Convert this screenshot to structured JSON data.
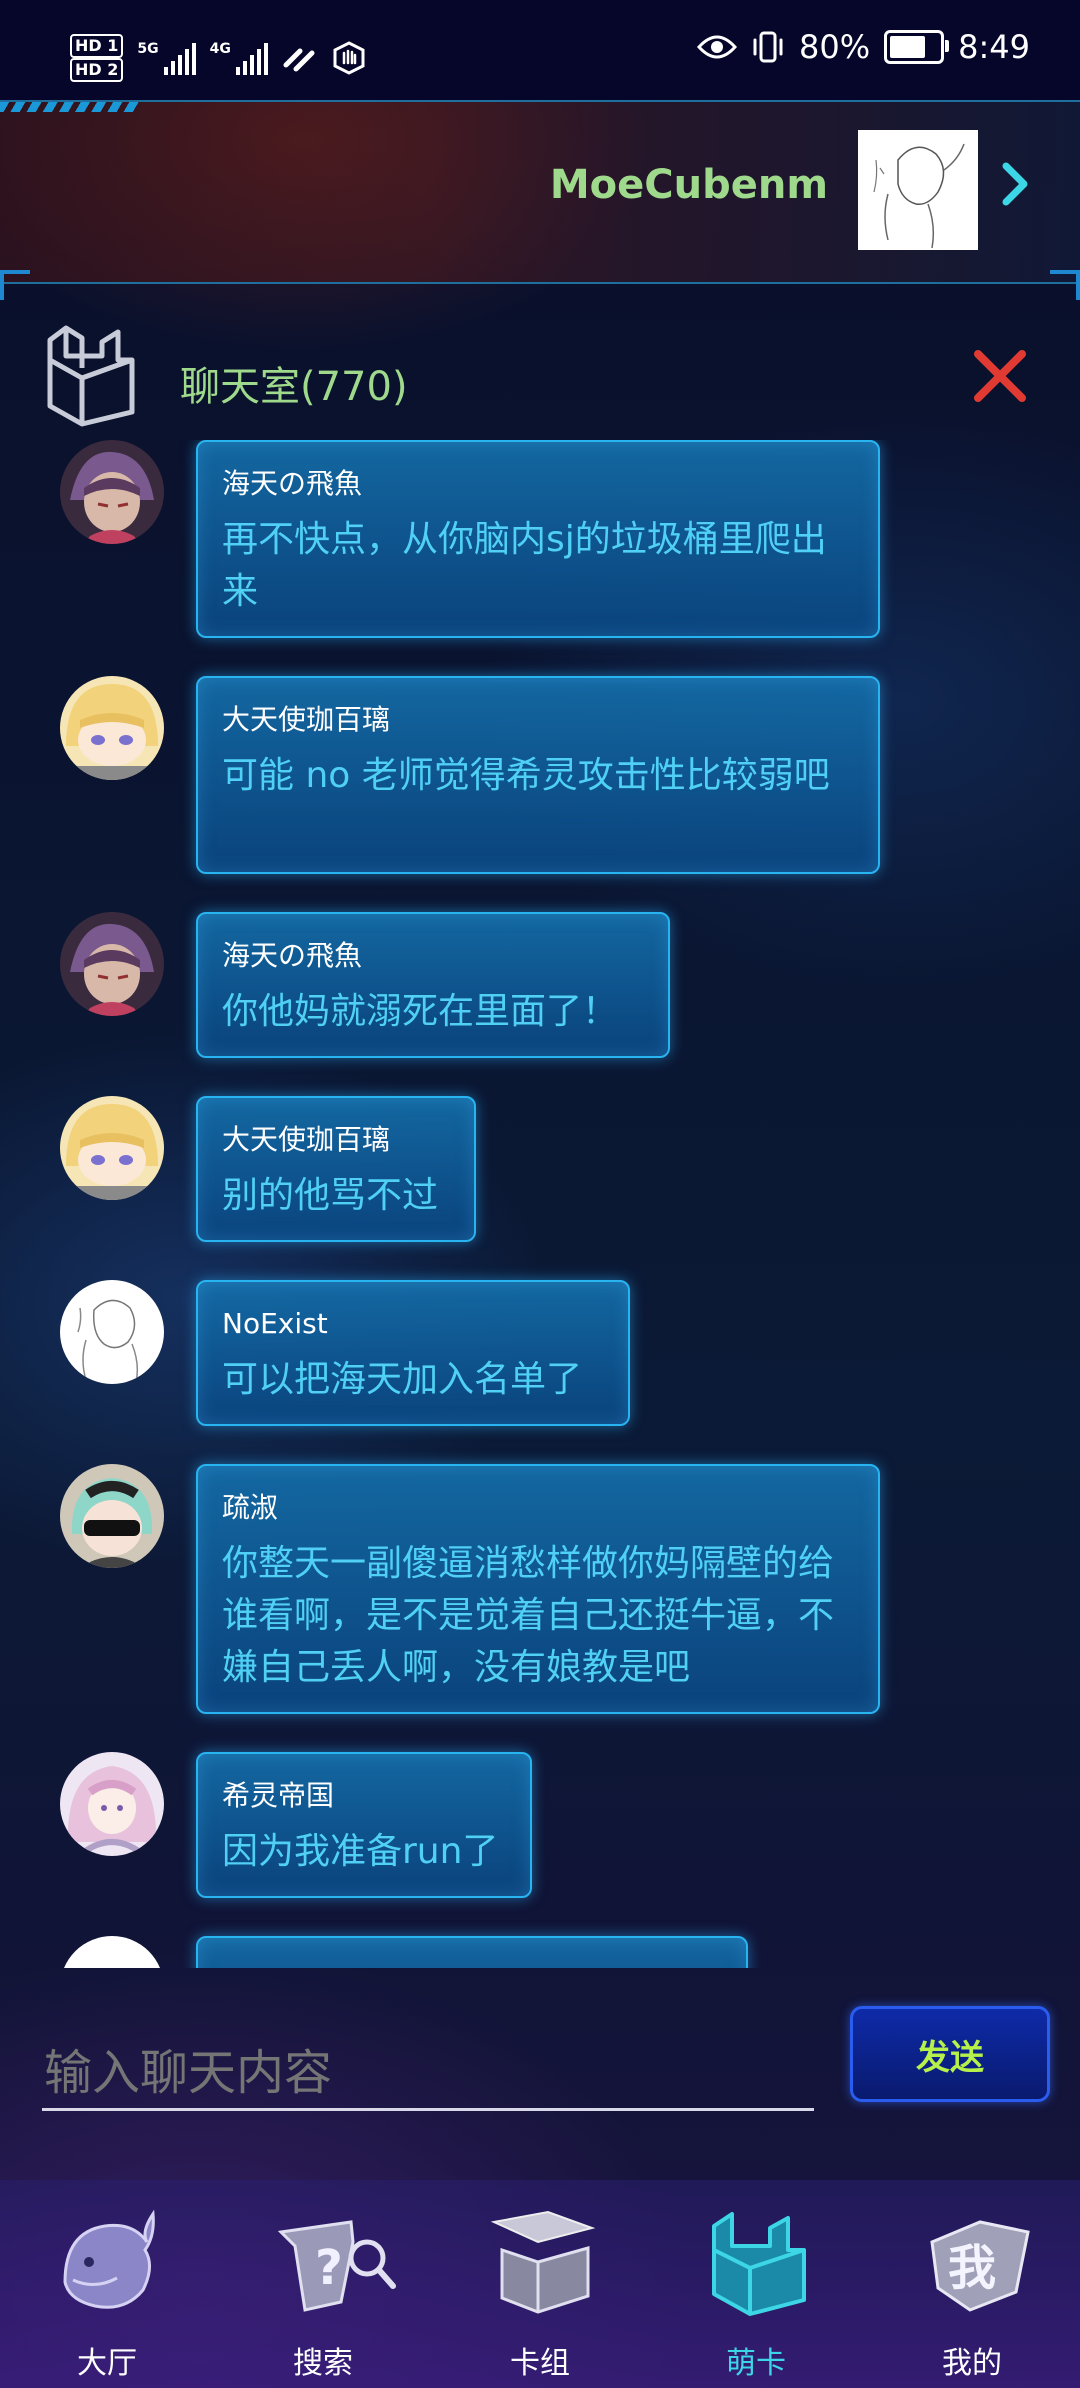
{
  "status_bar": {
    "hd1": "HD 1",
    "hd2": "HD 2",
    "net1": "5G",
    "net2": "4G",
    "battery_pct": "80%",
    "battery_level": 0.8,
    "time": "8:49",
    "icons": [
      "eye-icon",
      "vibrate-icon"
    ]
  },
  "header": {
    "username": "MoeCubenm"
  },
  "chat": {
    "title": "聊天室(770)",
    "messages": [
      {
        "name": "海天の飛魚",
        "text": "再不快点，从你脑内sj的垃圾桶里爬出来"
      },
      {
        "name": "大天使珈百璃",
        "text": "可能 no 老师觉得希灵攻击性比较弱吧"
      },
      {
        "name": "海天の飛魚",
        "text": "你他妈就溺死在里面了！"
      },
      {
        "name": "大天使珈百璃",
        "text": "别的他骂不过"
      },
      {
        "name": "NoExist",
        "text": "可以把海天加入名单了"
      },
      {
        "name": "疏淑",
        "text": "你整天一副傻逼消愁样做你妈隔壁的给谁看啊，是不是觉着自己还挺牛逼，不嫌自己丢人啊，没有娘教是吧"
      },
      {
        "name": "希灵帝国",
        "text": "因为我准备run了"
      }
    ]
  },
  "input": {
    "placeholder": "输入聊天内容",
    "value": ""
  },
  "send_label": "发送",
  "nav": {
    "items": [
      {
        "label": "大厅",
        "icon": "dolphin-icon"
      },
      {
        "label": "搜索",
        "icon": "search-hat-icon"
      },
      {
        "label": "卡组",
        "icon": "deck-box-icon"
      },
      {
        "label": "萌卡",
        "icon": "moecard-icon"
      },
      {
        "label": "我的",
        "icon": "profile-icon"
      }
    ],
    "active": "萌卡"
  },
  "colors": {
    "accent": "#3cd6e6",
    "username": "#9fd98b",
    "bubble_text": "#4fd0f4",
    "close": "#e03a32",
    "send_text": "#b6f04a"
  }
}
